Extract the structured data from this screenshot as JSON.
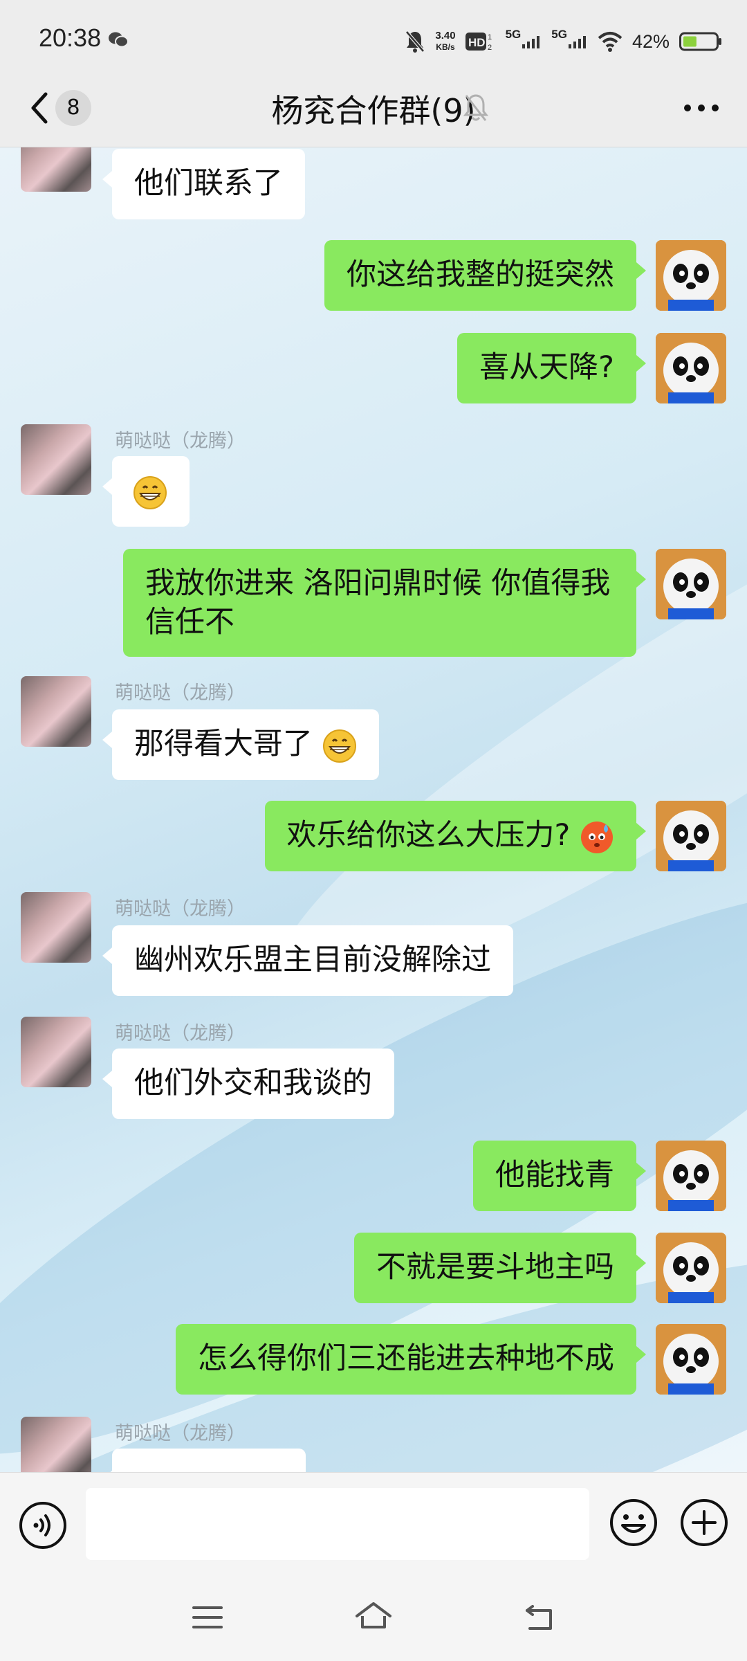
{
  "status_bar": {
    "time": "20:38",
    "net_speed_value": "3.40",
    "net_speed_unit": "KB/s",
    "hd_label": "HD",
    "sim1_label": "5G",
    "sim2_label": "5G",
    "battery_percent": "42%",
    "battery_level": 0.42
  },
  "header": {
    "unread_count": "8",
    "title": "杨兖合作群(9)"
  },
  "messages": [
    {
      "direction": "in",
      "text": "他们联系了"
    },
    {
      "direction": "out",
      "text": "你这给我整的挺突然"
    },
    {
      "direction": "out",
      "text": "喜从天降?"
    },
    {
      "direction": "in",
      "sender": "萌哒哒（龙腾）",
      "text": "",
      "emoji": "grin-emoji"
    },
    {
      "direction": "out",
      "text_line1": "我放你进来 洛阳问鼎时候 你值得我",
      "text_line2": "信任不"
    },
    {
      "direction": "in",
      "sender": "萌哒哒（龙腾）",
      "text": "那得看大哥了",
      "emoji": "grin-emoji"
    },
    {
      "direction": "out",
      "text": "欢乐给你这么大压力?",
      "emoji": "sweat-emoji"
    },
    {
      "direction": "in",
      "sender": "萌哒哒（龙腾）",
      "text": "幽州欢乐盟主目前没解除过"
    },
    {
      "direction": "in",
      "sender": "萌哒哒（龙腾）",
      "text": "他们外交和我谈的"
    },
    {
      "direction": "out",
      "text": "他能找青"
    },
    {
      "direction": "out",
      "text": "不就是要斗地主吗"
    },
    {
      "direction": "out",
      "text": "怎么得你们三还能进去种地不成"
    },
    {
      "direction": "in",
      "sender": "萌哒哒（龙腾）",
      "text": "",
      "partial": true
    }
  ],
  "colors": {
    "outgoing_bubble": "#89e95f",
    "incoming_bubble": "#ffffff",
    "header_bg": "#ededed"
  }
}
